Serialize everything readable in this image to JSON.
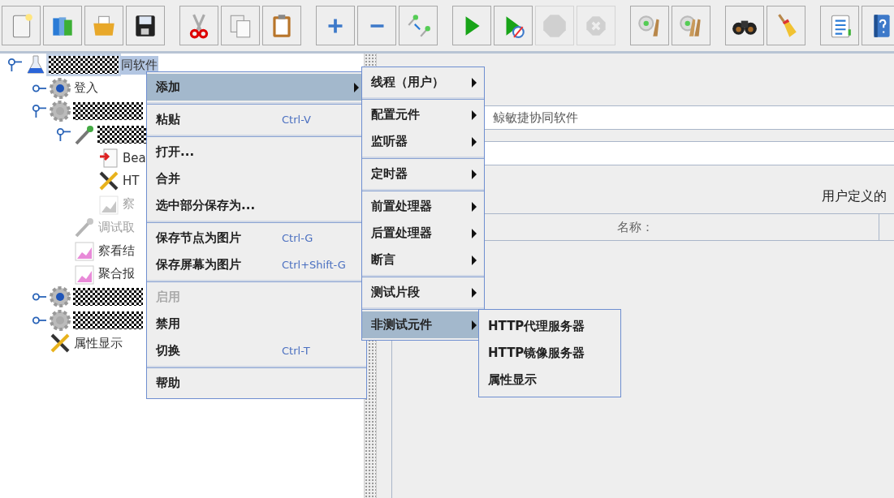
{
  "toolbar": [
    [
      {
        "kind": "page",
        "disabled": false
      },
      {
        "kind": "binders",
        "disabled": false
      },
      {
        "kind": "folder",
        "disabled": false
      },
      {
        "kind": "floppy",
        "disabled": false
      }
    ],
    [
      {
        "kind": "scissors",
        "disabled": false
      },
      {
        "kind": "copy",
        "disabled": false
      },
      {
        "kind": "clipboard",
        "disabled": false
      }
    ],
    [
      {
        "kind": "plus",
        "disabled": false
      },
      {
        "kind": "minus",
        "disabled": false
      },
      {
        "kind": "pipettes",
        "disabled": false
      }
    ],
    [
      {
        "kind": "play",
        "disabled": false
      },
      {
        "kind": "play-circle",
        "disabled": false
      },
      {
        "kind": "stop",
        "disabled": true
      },
      {
        "kind": "octagon-x",
        "disabled": true
      }
    ],
    [
      {
        "kind": "gear-broom",
        "disabled": false
      },
      {
        "kind": "gear-brooms",
        "disabled": false
      }
    ],
    [
      {
        "kind": "binoculars",
        "disabled": false
      },
      {
        "kind": "broom",
        "disabled": false
      }
    ],
    [
      {
        "kind": "list",
        "disabled": false
      },
      {
        "kind": "help-book",
        "disabled": false
      }
    ]
  ],
  "tree": [
    {
      "kind": "flask",
      "redacted": true,
      "label": "同软件",
      "selected": true,
      "disabled": false,
      "expanded": true,
      "children": [
        {
          "kind": "gear-blue",
          "label": "登入",
          "selected": false,
          "disabled": false,
          "expanded": false
        },
        {
          "kind": "gear-grey",
          "redacted": true,
          "selected": false,
          "disabled": false,
          "expanded": true,
          "children": [
            {
              "kind": "pipette",
              "redacted": true,
              "selected": false,
              "disabled": false,
              "expanded": true,
              "children": [
                {
                  "kind": "sampler",
                  "label": "Bea",
                  "selected": false,
                  "disabled": false
                },
                {
                  "kind": "tools",
                  "label": "HT",
                  "selected": false,
                  "disabled": false
                },
                {
                  "kind": "chart",
                  "label": "察",
                  "selected": false,
                  "disabled": true
                }
              ]
            },
            {
              "kind": "pipette",
              "label": "调试取",
              "selected": false,
              "disabled": true
            },
            {
              "kind": "chart",
              "label": "察看结",
              "selected": false,
              "disabled": false
            },
            {
              "kind": "chart",
              "label": "聚合报",
              "selected": false,
              "disabled": false
            }
          ]
        },
        {
          "kind": "gear-blue",
          "redacted": true,
          "selected": false,
          "disabled": false,
          "expanded": false
        },
        {
          "kind": "gear-grey",
          "redacted": true,
          "selected": false,
          "disabled": false,
          "expanded": false
        },
        {
          "kind": "tools",
          "label": "属性显示",
          "selected": false,
          "disabled": false
        }
      ]
    }
  ],
  "panel": {
    "name_value": "鲸敏捷协同软件",
    "section_title": "用户定义的",
    "table_columns": [
      "名称："
    ]
  },
  "context_menu": {
    "groups": [
      [
        {
          "label": "添加",
          "submenu": true,
          "selected": true,
          "disabled": false
        }
      ],
      [
        {
          "label": "粘贴",
          "shortcut": "Ctrl-V",
          "submenu": false,
          "selected": false,
          "disabled": false
        }
      ],
      [
        {
          "label": "打开...",
          "submenu": false,
          "selected": false,
          "disabled": false
        },
        {
          "label": "合并",
          "submenu": false,
          "selected": false,
          "disabled": false
        },
        {
          "label": "选中部分保存为...",
          "submenu": false,
          "selected": false,
          "disabled": false
        }
      ],
      [
        {
          "label": "保存节点为图片",
          "shortcut": "Ctrl-G",
          "submenu": false,
          "selected": false,
          "disabled": false
        },
        {
          "label": "保存屏幕为图片",
          "shortcut": "Ctrl+Shift-G",
          "submenu": false,
          "selected": false,
          "disabled": false
        }
      ],
      [
        {
          "label": "启用",
          "submenu": false,
          "selected": false,
          "disabled": true
        },
        {
          "label": "禁用",
          "submenu": false,
          "selected": false,
          "disabled": false
        },
        {
          "label": "切换",
          "shortcut": "Ctrl-T",
          "submenu": false,
          "selected": false,
          "disabled": false
        }
      ],
      [
        {
          "label": "帮助",
          "submenu": false,
          "selected": false,
          "disabled": false
        }
      ]
    ]
  },
  "add_submenu": {
    "groups": [
      [
        {
          "label": "线程（用户）",
          "submenu": true,
          "selected": false,
          "disabled": false
        }
      ],
      [
        {
          "label": "配置元件",
          "submenu": true,
          "selected": false,
          "disabled": false
        },
        {
          "label": "监听器",
          "submenu": true,
          "selected": false,
          "disabled": false
        }
      ],
      [
        {
          "label": "定时器",
          "submenu": true,
          "selected": false,
          "disabled": false
        }
      ],
      [
        {
          "label": "前置处理器",
          "submenu": true,
          "selected": false,
          "disabled": false
        },
        {
          "label": "后置处理器",
          "submenu": true,
          "selected": false,
          "disabled": false
        },
        {
          "label": "断言",
          "submenu": true,
          "selected": false,
          "disabled": false
        }
      ],
      [
        {
          "label": "测试片段",
          "submenu": true,
          "selected": false,
          "disabled": false
        }
      ],
      [
        {
          "label": "非测试元件",
          "submenu": true,
          "selected": true,
          "disabled": false
        }
      ]
    ]
  },
  "non_test_submenu": {
    "groups": [
      [
        {
          "label": "HTTP代理服务器",
          "submenu": false,
          "selected": false,
          "disabled": false
        },
        {
          "label": "HTTP镜像服务器",
          "submenu": false,
          "selected": false,
          "disabled": false
        },
        {
          "label": "属性显示",
          "submenu": false,
          "selected": false,
          "disabled": false
        }
      ]
    ]
  }
}
